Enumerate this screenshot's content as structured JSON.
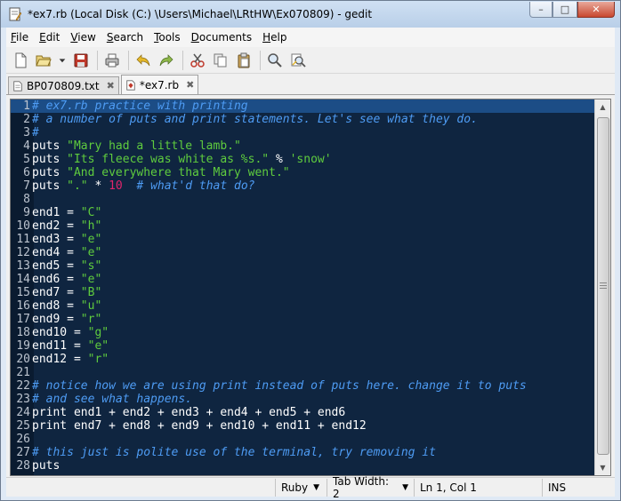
{
  "window": {
    "title": "*ex7.rb (Local Disk (C:) \\Users\\Michael\\LRtHW\\Ex070809) - gedit",
    "minimize": "–",
    "maximize": "□",
    "close": "✕"
  },
  "menubar": {
    "items": [
      {
        "pre": "",
        "u": "F",
        "post": "ile"
      },
      {
        "pre": "",
        "u": "E",
        "post": "dit"
      },
      {
        "pre": "",
        "u": "V",
        "post": "iew"
      },
      {
        "pre": "",
        "u": "S",
        "post": "earch"
      },
      {
        "pre": "",
        "u": "T",
        "post": "ools"
      },
      {
        "pre": "",
        "u": "D",
        "post": "ocuments"
      },
      {
        "pre": "",
        "u": "H",
        "post": "elp"
      }
    ]
  },
  "toolbar": {
    "icons": [
      "new-document-icon",
      "open-folder-icon",
      "dropdown-arrow-icon",
      "save-icon",
      "print-icon",
      "undo-icon",
      "redo-icon",
      "cut-icon",
      "copy-icon",
      "paste-icon",
      "find-icon",
      "find-replace-icon"
    ]
  },
  "tabs": [
    {
      "label": "BP070809.txt",
      "close": "✖"
    },
    {
      "label": "*ex7.rb",
      "close": "✖"
    }
  ],
  "editor": {
    "colors": {
      "background": "#0f2540",
      "comment": "#4e9cf4",
      "string": "#5fcc3e",
      "number": "#e0256b"
    },
    "lines": [
      {
        "n": "1",
        "t": "# ex7.rb practice with printing"
      },
      {
        "n": "2",
        "t": "# a number of puts and print statements. Let's see what they do."
      },
      {
        "n": "3",
        "t": "#"
      },
      {
        "n": "4",
        "t": "puts \"Mary had a little lamb.\""
      },
      {
        "n": "5",
        "t": "puts \"Its fleece was white as %s.\" % 'snow'"
      },
      {
        "n": "6",
        "t": "puts \"And everywhere that Mary went.\""
      },
      {
        "n": "7",
        "t": "puts \".\" * 10  # what'd that do?"
      },
      {
        "n": "8",
        "t": ""
      },
      {
        "n": "9",
        "t": "end1 = \"C\""
      },
      {
        "n": "10",
        "t": "end2 = \"h\""
      },
      {
        "n": "11",
        "t": "end3 = \"e\""
      },
      {
        "n": "12",
        "t": "end4 = \"e\""
      },
      {
        "n": "13",
        "t": "end5 = \"s\""
      },
      {
        "n": "14",
        "t": "end6 = \"e\""
      },
      {
        "n": "15",
        "t": "end7 = \"B\""
      },
      {
        "n": "16",
        "t": "end8 = \"u\""
      },
      {
        "n": "17",
        "t": "end9 = \"r\""
      },
      {
        "n": "18",
        "t": "end10 = \"g\""
      },
      {
        "n": "19",
        "t": "end11 = \"e\""
      },
      {
        "n": "20",
        "t": "end12 = \"r\""
      },
      {
        "n": "21",
        "t": ""
      },
      {
        "n": "22",
        "t": "# notice how we are using print instead of puts here. change it to puts"
      },
      {
        "n": "23",
        "t": "# and see what happens."
      },
      {
        "n": "24",
        "t": "print end1 + end2 + end3 + end4 + end5 + end6"
      },
      {
        "n": "25",
        "t": "print end7 + end8 + end9 + end10 + end11 + end12"
      },
      {
        "n": "26",
        "t": ""
      },
      {
        "n": "27",
        "t": "# this just is polite use of the terminal, try removing it"
      },
      {
        "n": "28",
        "t": "puts"
      }
    ]
  },
  "statusbar": {
    "language": "Ruby",
    "tab_width": "Tab Width: 2",
    "position": "Ln 1, Col 1",
    "mode": "INS"
  }
}
